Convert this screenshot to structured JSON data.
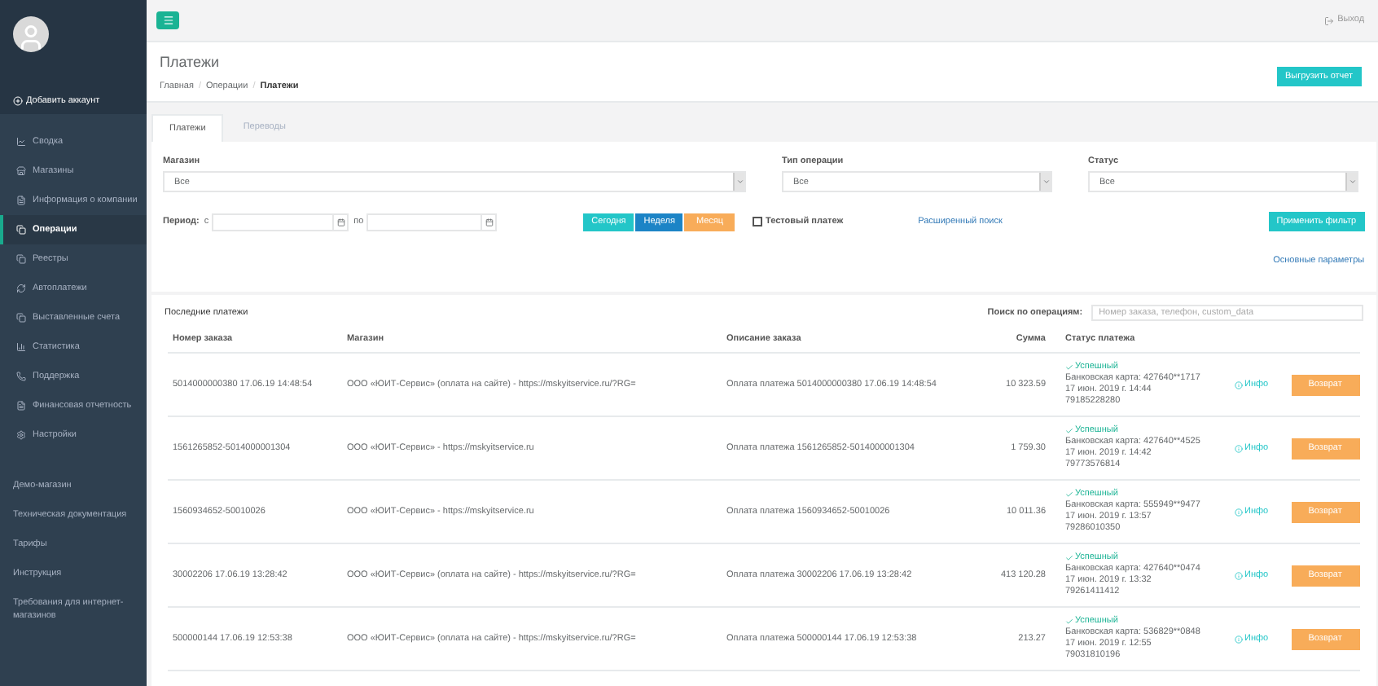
{
  "sidebar": {
    "add_account": "Добавить аккаунт",
    "items": [
      {
        "kind": "chart",
        "label": "Сводка",
        "selected": false
      },
      {
        "kind": "store",
        "label": "Магазины",
        "selected": false
      },
      {
        "kind": "doc",
        "label": "Информация о компании",
        "selected": false
      },
      {
        "kind": "copy",
        "label": "Операции",
        "selected": true
      },
      {
        "kind": "copy",
        "label": "Реестры",
        "selected": false
      },
      {
        "kind": "refresh",
        "label": "Автоплатежи",
        "selected": false
      },
      {
        "kind": "copy",
        "label": "Выставленные счета",
        "selected": false
      },
      {
        "kind": "bar",
        "label": "Статистика",
        "selected": false
      },
      {
        "kind": "phone",
        "label": "Поддержка",
        "selected": false
      },
      {
        "kind": "doc",
        "label": "Финансовая отчетность",
        "selected": false
      },
      {
        "kind": "gear",
        "label": "Настройки",
        "selected": false
      }
    ],
    "links": [
      "Демо-магазин",
      "Техническая документация",
      "Тарифы",
      "Инструкция",
      "Требования для интернет-магазинов"
    ]
  },
  "topbar": {
    "logout": "Выход"
  },
  "header": {
    "title": "Платежи",
    "breadcrumbs": [
      "Главная",
      "Операции",
      "Платежи"
    ],
    "breadcrumb_separator": "/",
    "export_button": "Выгрузить отчет"
  },
  "tabs": [
    {
      "label": "Платежи",
      "selected": true
    },
    {
      "label": "Переводы",
      "selected": false
    }
  ],
  "filters": {
    "selects": [
      {
        "label": "Магазин",
        "value": "Все"
      },
      {
        "label": "Тип операции",
        "value": "Все"
      },
      {
        "label": "Статус",
        "value": "Все"
      }
    ],
    "period_label": "Период:",
    "from": "с",
    "to": "по",
    "quick": [
      "Сегодня",
      "Неделя",
      "Месяц"
    ],
    "test_payment": {
      "label": "Тестовый платеж",
      "checked": false
    },
    "advanced_link": "Расширенный поиск",
    "apply_button": "Применить фильтр",
    "basic_link": "Основные параметры"
  },
  "table": {
    "title": "Последние платежи",
    "search_label": "Поиск по операциям:",
    "search_placeholder": "Номер заказа, телефон, custom_data",
    "columns": [
      "Номер заказа",
      "Магазин",
      "Описание заказа",
      "Сумма",
      "Статус платежа"
    ],
    "rows": [
      {
        "order": "5014000000380 17.06.19 14:48:54",
        "shop": "ООО «ЮИТ-Сервис» (оплата на сайте) - https://mskyitservice.ru/?RG=",
        "description": "Оплата платежа 5014000000380 17.06.19 14:48:54",
        "amount": "10 323.59",
        "status": "Успешный",
        "card": "Банковская карта: 427640**1717",
        "date": "17 июн. 2019 г. 14:44",
        "phone": "79185228280",
        "info": "Инфо",
        "refund": "Возврат"
      },
      {
        "order": "1561265852-5014000001304",
        "shop": "ООО «ЮИТ-Сервис» - https://mskyitservice.ru",
        "description": "Оплата платежа 1561265852-5014000001304",
        "amount": "1 759.30",
        "status": "Успешный",
        "card": "Банковская карта: 427640**4525",
        "date": "17 июн. 2019 г. 14:42",
        "phone": "79773576814",
        "info": "Инфо",
        "refund": "Возврат"
      },
      {
        "order": "1560934652-50010026",
        "shop": "ООО «ЮИТ-Сервис» - https://mskyitservice.ru",
        "description": "Оплата платежа 1560934652-50010026",
        "amount": "10 011.36",
        "status": "Успешный",
        "card": "Банковская карта: 555949**9477",
        "date": "17 июн. 2019 г. 13:57",
        "phone": "79286010350",
        "info": "Инфо",
        "refund": "Возврат"
      },
      {
        "order": "30002206 17.06.19 13:28:42",
        "shop": "ООО «ЮИТ-Сервис» (оплата на сайте) - https://mskyitservice.ru/?RG=",
        "description": "Оплата платежа 30002206 17.06.19 13:28:42",
        "amount": "413 120.28",
        "status": "Успешный",
        "card": "Банковская карта: 427640**0474",
        "date": "17 июн. 2019 г. 13:32",
        "phone": "79261411412",
        "info": "Инфо",
        "refund": "Возврат"
      },
      {
        "order": "500000144 17.06.19 12:53:38",
        "shop": "ООО «ЮИТ-Сервис» (оплата на сайте) - https://mskyitservice.ru/?RG=",
        "description": "Оплата платежа 500000144 17.06.19 12:53:38",
        "amount": "213.27",
        "status": "Успешный",
        "card": "Банковская карта: 536829**0848",
        "date": "17 июн. 2019 г. 12:55",
        "phone": "79031810196",
        "info": "Инфо",
        "refund": "Возврат"
      }
    ]
  }
}
